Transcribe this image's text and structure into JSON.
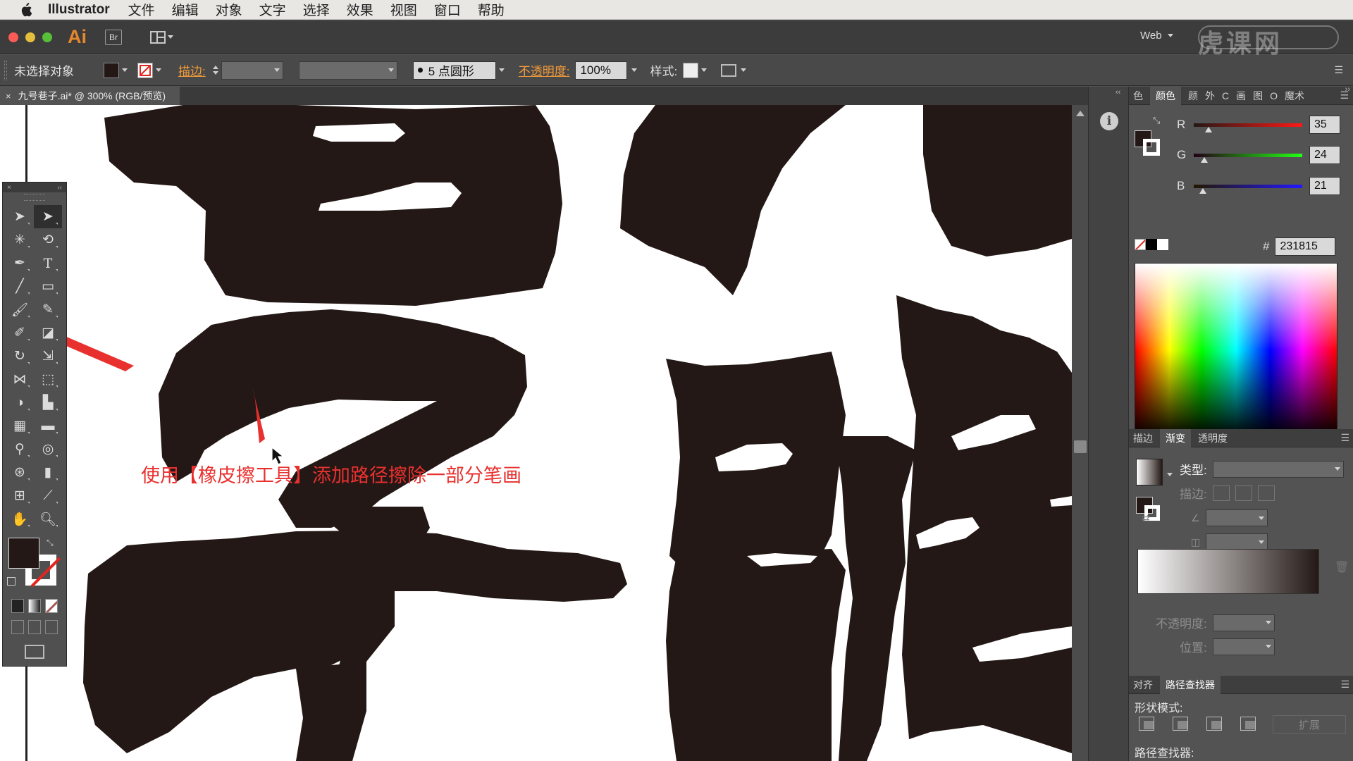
{
  "menubar": {
    "app": "Illustrator",
    "items": [
      "文件",
      "编辑",
      "对象",
      "文字",
      "选择",
      "效果",
      "视图",
      "窗口",
      "帮助"
    ]
  },
  "appbar": {
    "logo": "Ai",
    "bridge": "Br",
    "workspace": "Web",
    "watermark": "虎课网"
  },
  "control": {
    "selection": "未选择对象",
    "stroke_label": "描边:",
    "brush": "5 点圆形",
    "opacity_label": "不透明度:",
    "opacity_value": "100%",
    "style_label": "样式:"
  },
  "document": {
    "tab_title": "九号巷子.ai* @ 300% (RGB/预览)"
  },
  "annotation": {
    "text": "使用【橡皮擦工具】添加路径擦除一部分笔画"
  },
  "color_panel": {
    "tabs": [
      "色",
      "颜色",
      "颜",
      "外",
      "C",
      "画",
      "图",
      "O",
      "魔术"
    ],
    "r_label": "R",
    "r": "35",
    "g_label": "G",
    "g": "24",
    "b_label": "B",
    "b": "21",
    "hex_label": "#",
    "hex": "231815",
    "fill_color": "#231815"
  },
  "gradient_panel": {
    "tabs": [
      "描边",
      "渐变",
      "透明度"
    ],
    "type_label": "类型:",
    "stroke_label": "描边:",
    "opacity_label": "不透明度:",
    "position_label": "位置:"
  },
  "pathfinder_panel": {
    "tabs": [
      "对齐",
      "路径查找器"
    ],
    "shape_modes": "形状模式:",
    "expand": "扩展",
    "pathfinders": "路径查找器:"
  },
  "colors": {
    "ink": "#231815",
    "annotation": "#e8312f",
    "accent_orange": "#f29b3a"
  }
}
